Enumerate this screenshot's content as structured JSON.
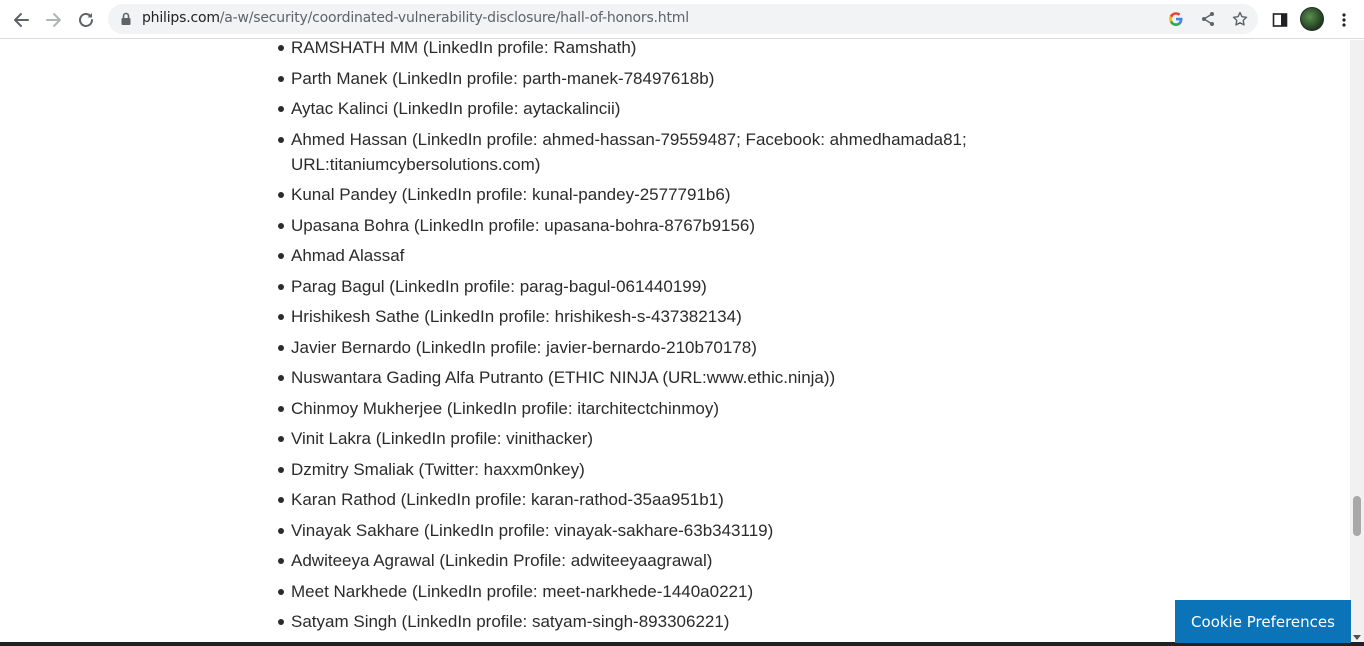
{
  "browser": {
    "url_host": "philips.com",
    "url_path": "/a-w/security/coordinated-vulnerability-disclosure/hall-of-honors.html",
    "icons": {
      "back": "back-arrow-icon",
      "forward": "forward-arrow-icon",
      "reload": "reload-icon",
      "lock": "lock-icon",
      "google": "google-icon",
      "share": "share-icon",
      "bookmark": "star-icon",
      "side_panel": "side-panel-icon",
      "profile": "avatar",
      "menu": "kebab-menu-icon"
    }
  },
  "hall_of_honors": {
    "entries": [
      "RAMSHATH MM (LinkedIn profile: Ramshath)",
      "Parth Manek (LinkedIn profile: parth-manek-78497618b)",
      "Aytac Kalinci (LinkedIn profile: aytackalincii)",
      "Ahmed Hassan (LinkedIn profile: ahmed-hassan-79559487; Facebook: ahmedhamada81; URL:titaniumcybersolutions.com)",
      "Kunal Pandey (LinkedIn profile: kunal-pandey-2577791b6)",
      "Upasana Bohra (LinkedIn profile: upasana-bohra-8767b9156)",
      "Ahmad Alassaf",
      "Parag Bagul (LinkedIn profile: parag-bagul-061440199)",
      "Hrishikesh Sathe (LinkedIn profile: hrishikesh-s-437382134)",
      "Javier Bernardo (LinkedIn profile: javier-bernardo-210b70178)",
      "Nuswantara Gading Alfa Putranto  (ETHIC NINJA (URL:www.ethic.ninja))",
      "Chinmoy Mukherjee (LinkedIn profile: itarchitectchinmoy)",
      "Vinit Lakra (LinkedIn profile: vinithacker)",
      "Dzmitry Smaliak (Twitter: haxxm0nkey)",
      "Karan Rathod (LinkedIn profile: karan-rathod-35aa951b1)",
      "Vinayak Sakhare (LinkedIn profile: vinayak-sakhare-63b343119)",
      "Adwiteeya Agrawal (Linkedin Profile: adwiteeyaagrawal)",
      "Meet Narkhede (LinkedIn profile: meet-narkhede-1440a0221)",
      "Satyam Singh (LinkedIn profile: satyam-singh-893306221)"
    ]
  },
  "cookie": {
    "label": "Cookie Preferences",
    "color": "#0b73b7"
  }
}
